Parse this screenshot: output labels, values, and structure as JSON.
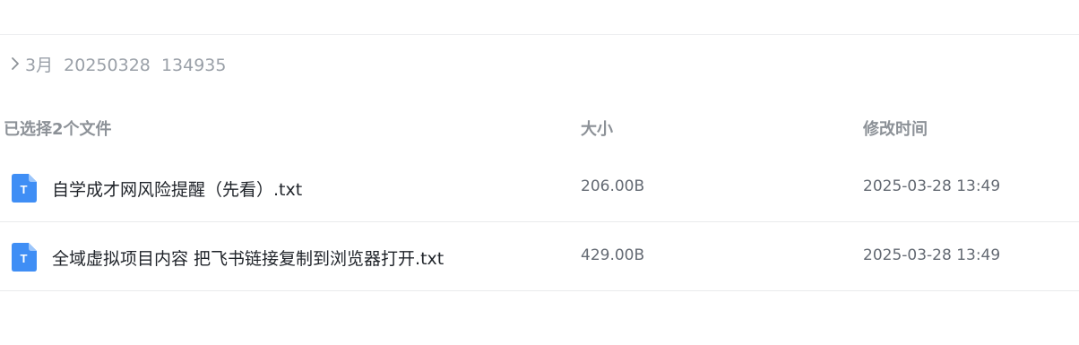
{
  "breadcrumb": {
    "icon": "chevron-right-icon",
    "text": "3月  20250328  134935"
  },
  "table": {
    "headers": {
      "name": "已选择2个文件",
      "size": "大小",
      "modified": "修改时间"
    },
    "rows": [
      {
        "icon": "text-file-icon",
        "name": "自学成才网风险提醒（先看）.txt",
        "size": "206.00B",
        "modified": "2025-03-28 13:49"
      },
      {
        "icon": "text-file-icon",
        "name": "全域虚拟项目内容 把飞书链接复制到浏览器打开.txt",
        "size": "429.00B",
        "modified": "2025-03-28 13:49"
      }
    ]
  },
  "colors": {
    "file_icon_blue": "#3f8ef5",
    "file_icon_fold": "#9cc6fb",
    "text_primary": "#1f2329",
    "text_secondary": "#646a73",
    "header_text": "#8c9197",
    "divider": "#e9eaec"
  },
  "file_icon_letter": "T"
}
